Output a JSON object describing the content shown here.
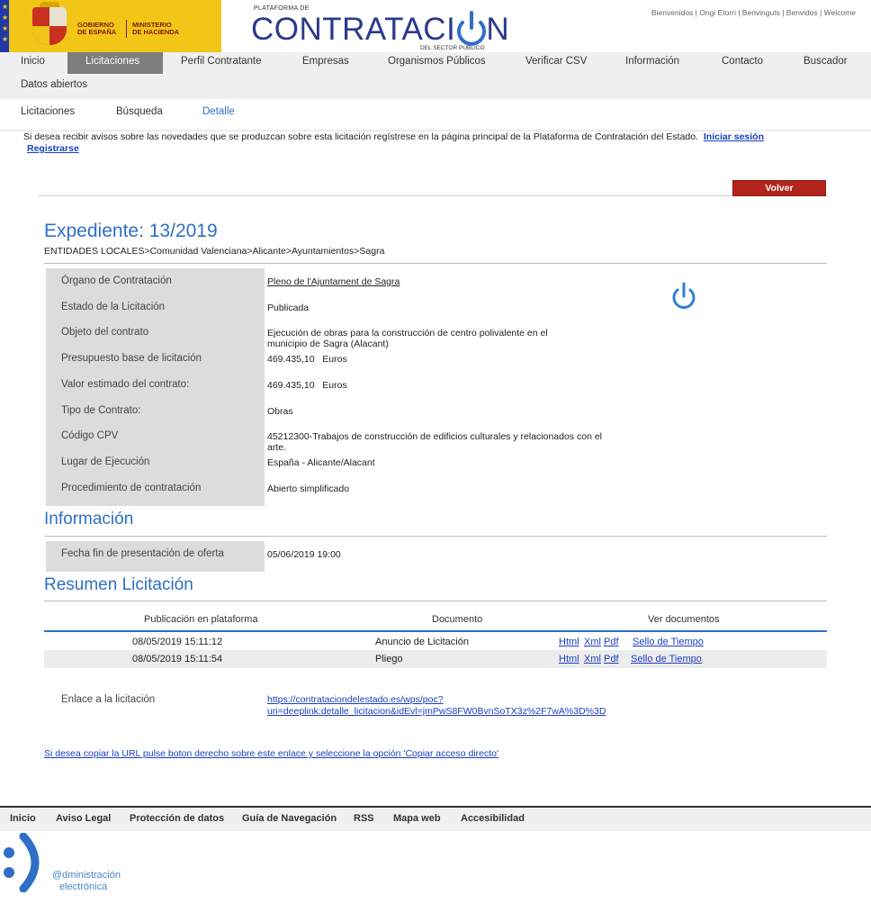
{
  "header": {
    "gov_line1": [
      "GOBIERNO",
      "DE ESPAÑA"
    ],
    "gov_line2": [
      "MINISTERIO",
      "DE HACIENDA"
    ],
    "brand_small": "PLATAFORMA DE",
    "brand_main": "CONTRATACI",
    "brand_end": "N",
    "brand_sub": "DEL SECTOR PÚBLICO",
    "welcome": "Bienvenidos | Ongi Etorri | Benvinguts | Benvidos | Welcome",
    "accent_color": "#2b3a8a",
    "banner_color": "#f2c617"
  },
  "main_nav": {
    "items": [
      "Inicio",
      "Licitaciones",
      "Perfil Contratante",
      "Empresas",
      "Organismos Públicos",
      "Verificar CSV",
      "Información",
      "Contacto",
      "Buscador",
      "Datos abiertos"
    ],
    "active": "Licitaciones"
  },
  "sub_nav": {
    "items": [
      "Licitaciones",
      "Búsqueda",
      "Detalle"
    ],
    "active": "Detalle"
  },
  "notice": {
    "text": "Si desea recibir avisos sobre las novedades que se produzcan sobre esta licitación regístrese en la página principal de la Plataforma de Contratación del Estado.",
    "login": "Iniciar sesión",
    "register": "Registrarse"
  },
  "volver_label": "Volver",
  "expediente": {
    "title": "Expediente:  13/2019",
    "breadcrumb": "ENTIDADES LOCALES>Comunidad Valenciana>Alicante>Ayuntamientos>Sagra",
    "fields": [
      {
        "label": "Órgano de Contratación",
        "value": "Pleno de l'Ajuntament de Sagra"
      },
      {
        "label": "Estado de la Licitación",
        "value": "Publicada"
      },
      {
        "label": "Objeto del contrato",
        "value": "Ejecución de obras para la construcción de centro polivalente en el municipio de Sagra (Alacant)"
      },
      {
        "label": "Presupuesto base de licitación",
        "value": "469.435,10   Euros"
      },
      {
        "label": "Valor estimado del contrato:",
        "value": "469.435,10   Euros"
      },
      {
        "label": "Tipo de Contrato:",
        "value": "Obras"
      },
      {
        "label": "Código CPV",
        "value": "45212300-Trabajos de construcción de edificios culturales y relacionados con el arte."
      },
      {
        "label": "Lugar de Ejecución",
        "value": "España - Alicante/Alacant"
      },
      {
        "label": "Procedimiento de contratación",
        "value": "Abierto simplificado"
      }
    ]
  },
  "informacion": {
    "title": "Información",
    "label": "Fecha fin de presentación de oferta",
    "value": "05/06/2019 19:00"
  },
  "resumen": {
    "title": "Resumen Licitación",
    "headers": [
      "Publicación en plataforma",
      "Documento",
      "Ver documentos"
    ],
    "rows": [
      {
        "date": "08/05/2019 15:11:12",
        "doc": "Anuncio de Licitación",
        "links": [
          "Html",
          "Xml",
          "Pdf",
          "Sello de Tiempo"
        ]
      },
      {
        "date": "08/05/2019 15:11:54",
        "doc": "Pliego",
        "links": [
          "Html",
          "Xml",
          "Pdf",
          "Sello de Tiempo"
        ]
      }
    ]
  },
  "enlace": {
    "label": "Enlace a la licitación",
    "url_line1": "https://contrataciondelestado.es/wps/poc?",
    "url_line2": "uri=deeplink:detalle_licitacion&idEvl=jmPwS8FW0BvnSoTX3z%2F7wA%3D%3D"
  },
  "copy_hint": "Si desea copiar la URL pulse boton derecho sobre este enlace y seleccione la opción 'Copiar acceso directo'",
  "footer": {
    "items": [
      "Inicio",
      "Aviso Legal",
      "Protección de datos",
      "Guía de Navegación",
      "RSS",
      "Mapa web",
      "Accesibilidad"
    ],
    "ae_line1": "@dministración",
    "ae_line2": "electrónica"
  }
}
